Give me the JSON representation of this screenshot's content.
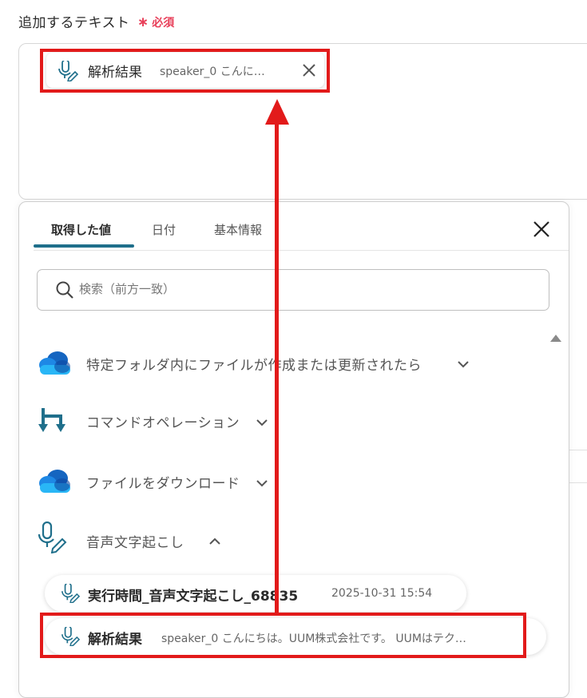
{
  "field": {
    "label": "追加するテキスト",
    "required_mark": "∗",
    "required_text": "必須"
  },
  "selected_chip": {
    "title": "解析結果",
    "value": "speaker_0 こんに…",
    "icon": "mic-pen-icon"
  },
  "panel": {
    "tabs": [
      {
        "label": "取得した値",
        "active": true
      },
      {
        "label": "日付",
        "active": false
      },
      {
        "label": "基本情報",
        "active": false
      }
    ],
    "search": {
      "placeholder": "検索（前方一致）"
    },
    "sections": [
      {
        "label": "特定フォルダ内にファイルが作成または更新されたら",
        "icon": "onedrive-cloud-icon",
        "expanded": false
      },
      {
        "label": "コマンドオペレーション",
        "icon": "command-operation-icon",
        "expanded": false
      },
      {
        "label": "ファイルをダウンロード",
        "icon": "onedrive-cloud-icon",
        "expanded": false
      },
      {
        "label": "音声文字起こし",
        "icon": "mic-pen-icon",
        "expanded": true
      }
    ],
    "items": [
      {
        "title": "実行時間_音声文字起こし_68835",
        "value": "2025-10-31 15:54"
      },
      {
        "title": "解析結果",
        "value": "speaker_0 こんにちは。UUM株式会社です。 UUMはテク…"
      }
    ]
  },
  "colors": {
    "accent": "#1f6f8b",
    "required": "#e8405a",
    "annotation": "#e21a1a"
  }
}
